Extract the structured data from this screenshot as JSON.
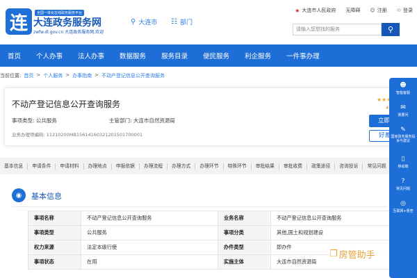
{
  "header": {
    "logo_char": "连",
    "logo_tag": "全国一体化在线政务服务平台",
    "site_title": "大连政务服务网",
    "site_sub": "zwfw.dl.gov.cn 大连政务服务网,欢迎",
    "location": "大连市",
    "dept": "部门",
    "gov_link": "大连市人民政府",
    "accessibility": "无障碍",
    "register": "注册",
    "login": "登录",
    "search_placeholder": "请输入您想找的服务"
  },
  "nav": [
    "首页",
    "个人办事",
    "法人办事",
    "数据服务",
    "服务目录",
    "便民服务",
    "利企服务",
    "一件事办理"
  ],
  "breadcrumb": {
    "label": "当前位置:",
    "items": [
      "首页",
      "个人服务",
      "办事指南",
      "不动产登记信息公开查询服务"
    ],
    "sep": ">"
  },
  "service": {
    "title": "不动产登记信息公开查询服务",
    "type": "事项类型:  公共服务",
    "dept": "主管部门:  大连市自然资源局",
    "code": "业务办理项编码:  11210200MB1561416032120150170000​1",
    "stars": "★★★",
    "score": "4",
    "apply": "立即办理",
    "evaluate": "好差评"
  },
  "tabs": [
    "基本信息",
    "申请条件",
    "申请材料",
    "办理地点",
    "申报依据",
    "办理流程",
    "办理方式",
    "办理环节",
    "特殊环节",
    "审批结果",
    "审批收费",
    "政策途径",
    "咨询投诉",
    "常见问题"
  ],
  "section": {
    "title": "基本信息"
  },
  "table": [
    [
      "事项名称",
      "不动产登记信息公开查询服务",
      "业务名称",
      "不动产登记信息公开查询服务"
    ],
    [
      "事项类型",
      "公共服务",
      "事项分类",
      "其他,国土和规划建设"
    ],
    [
      "权力来源",
      "法定本级行使",
      "办件类型",
      "即办件"
    ],
    [
      "事项状态",
      "在用",
      "实施主体",
      "大连市自然资源局"
    ]
  ],
  "watermark": "房管助手",
  "sidebar": [
    {
      "icon": "robot-icon",
      "label": "智能客服"
    },
    {
      "icon": "chat-icon",
      "label": "我要问"
    },
    {
      "icon": "feedback-icon",
      "label": "国家政务服务投诉与建议"
    },
    {
      "icon": "mobile-icon",
      "label": "移动端"
    },
    {
      "icon": "question-icon",
      "label": "常见问题"
    },
    {
      "icon": "globe-icon",
      "label": "互联网+督查"
    }
  ]
}
